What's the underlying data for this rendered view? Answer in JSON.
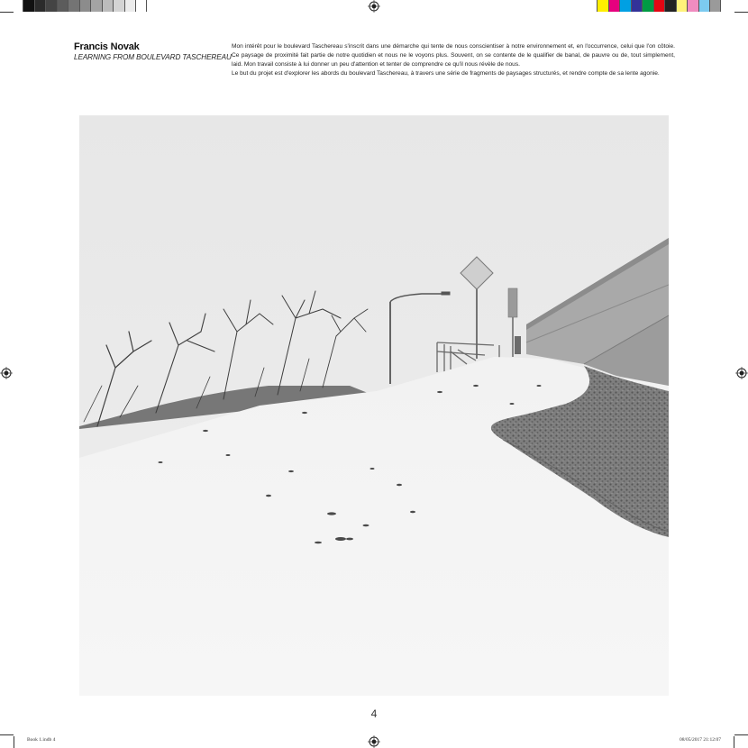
{
  "header": {
    "author": "Francis Novak",
    "series_title": "LEARNING FROM BOULEVARD TASCHEREAU",
    "statement": [
      "Mon intérêt pour le boulevard Taschereau s'inscrit dans une démarche qui tente de nous conscientiser à notre environnement et, en l'occurrence, celui que l'on côtoie. Ce paysage de proximité fait partie de notre quotidien et nous ne le voyons plus. Souvent, on se contente de le qualifier de banal, de pauvre ou de, tout simplement, laid. Mon travail consiste à lui donner un peu d'attention et tenter de comprendre ce qu'il nous révèle de nous.",
      "Le but du projet est d'explorer les abords du boulevard Taschereau, à travers une série de fragments de paysages structurés, et rendre compte de sa lente agonie."
    ]
  },
  "page_number": "4",
  "slug": {
    "left": "Book 1.indb   4",
    "right": "08/05/2017   21:12:07"
  },
  "print_marks": {
    "gray_steps": [
      "#111111",
      "#2b2b2b",
      "#444444",
      "#5c5c5c",
      "#747474",
      "#8c8c8c",
      "#a4a4a4",
      "#bcbcbc",
      "#d4d4d4",
      "#ececec",
      "#ffffff"
    ],
    "color_steps": [
      "#ffee00",
      "#e6007e",
      "#00a0e3",
      "#333399",
      "#009a44",
      "#e30613",
      "#222222",
      "#fff27a",
      "#f08cc0",
      "#7ccbf0",
      "#9a9a9a"
    ]
  }
}
